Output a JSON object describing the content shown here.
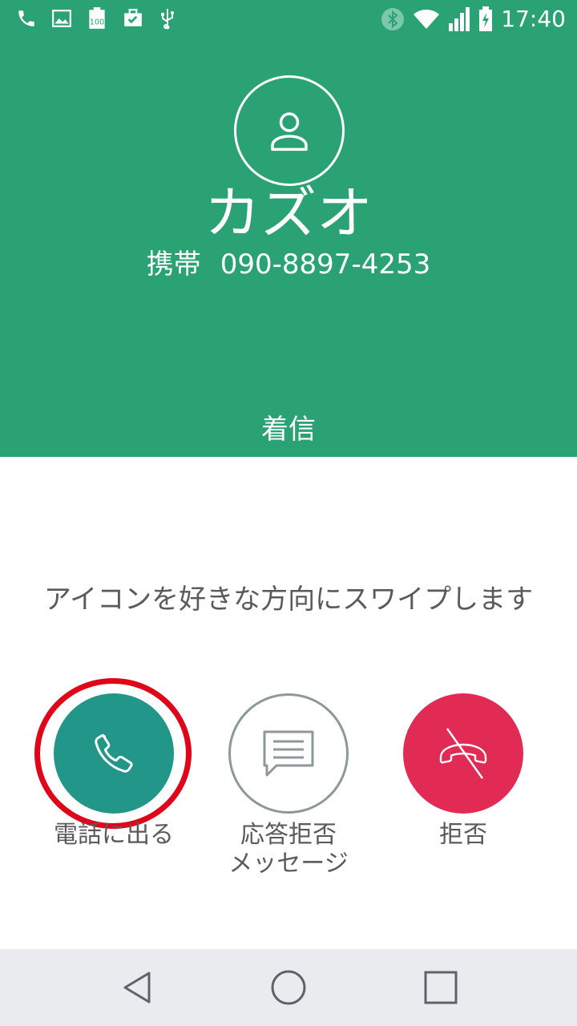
{
  "status_bar": {
    "time": "17:40",
    "left_icons": [
      "phone-icon",
      "image-icon",
      "battery-100-icon",
      "briefcase-check-icon",
      "usb-icon"
    ],
    "right_icons": [
      "bluetooth-icon",
      "wifi-icon",
      "signal-icon",
      "battery-charging-icon"
    ]
  },
  "caller": {
    "name": "カズオ",
    "number_type": "携帯",
    "number": "090-8897-4253",
    "state": "着信"
  },
  "instruction": "アイコンを好きな方向にスワイプします",
  "actions": {
    "answer_label": "電話に出る",
    "reject_message_label_line1": "応答拒否",
    "reject_message_label_line2": "メッセージ",
    "decline_label": "拒否"
  },
  "colors": {
    "header_green": "#2ba273",
    "answer_teal": "#23968a",
    "decline_red": "#e22b54",
    "highlight_ring": "#e0061a"
  }
}
